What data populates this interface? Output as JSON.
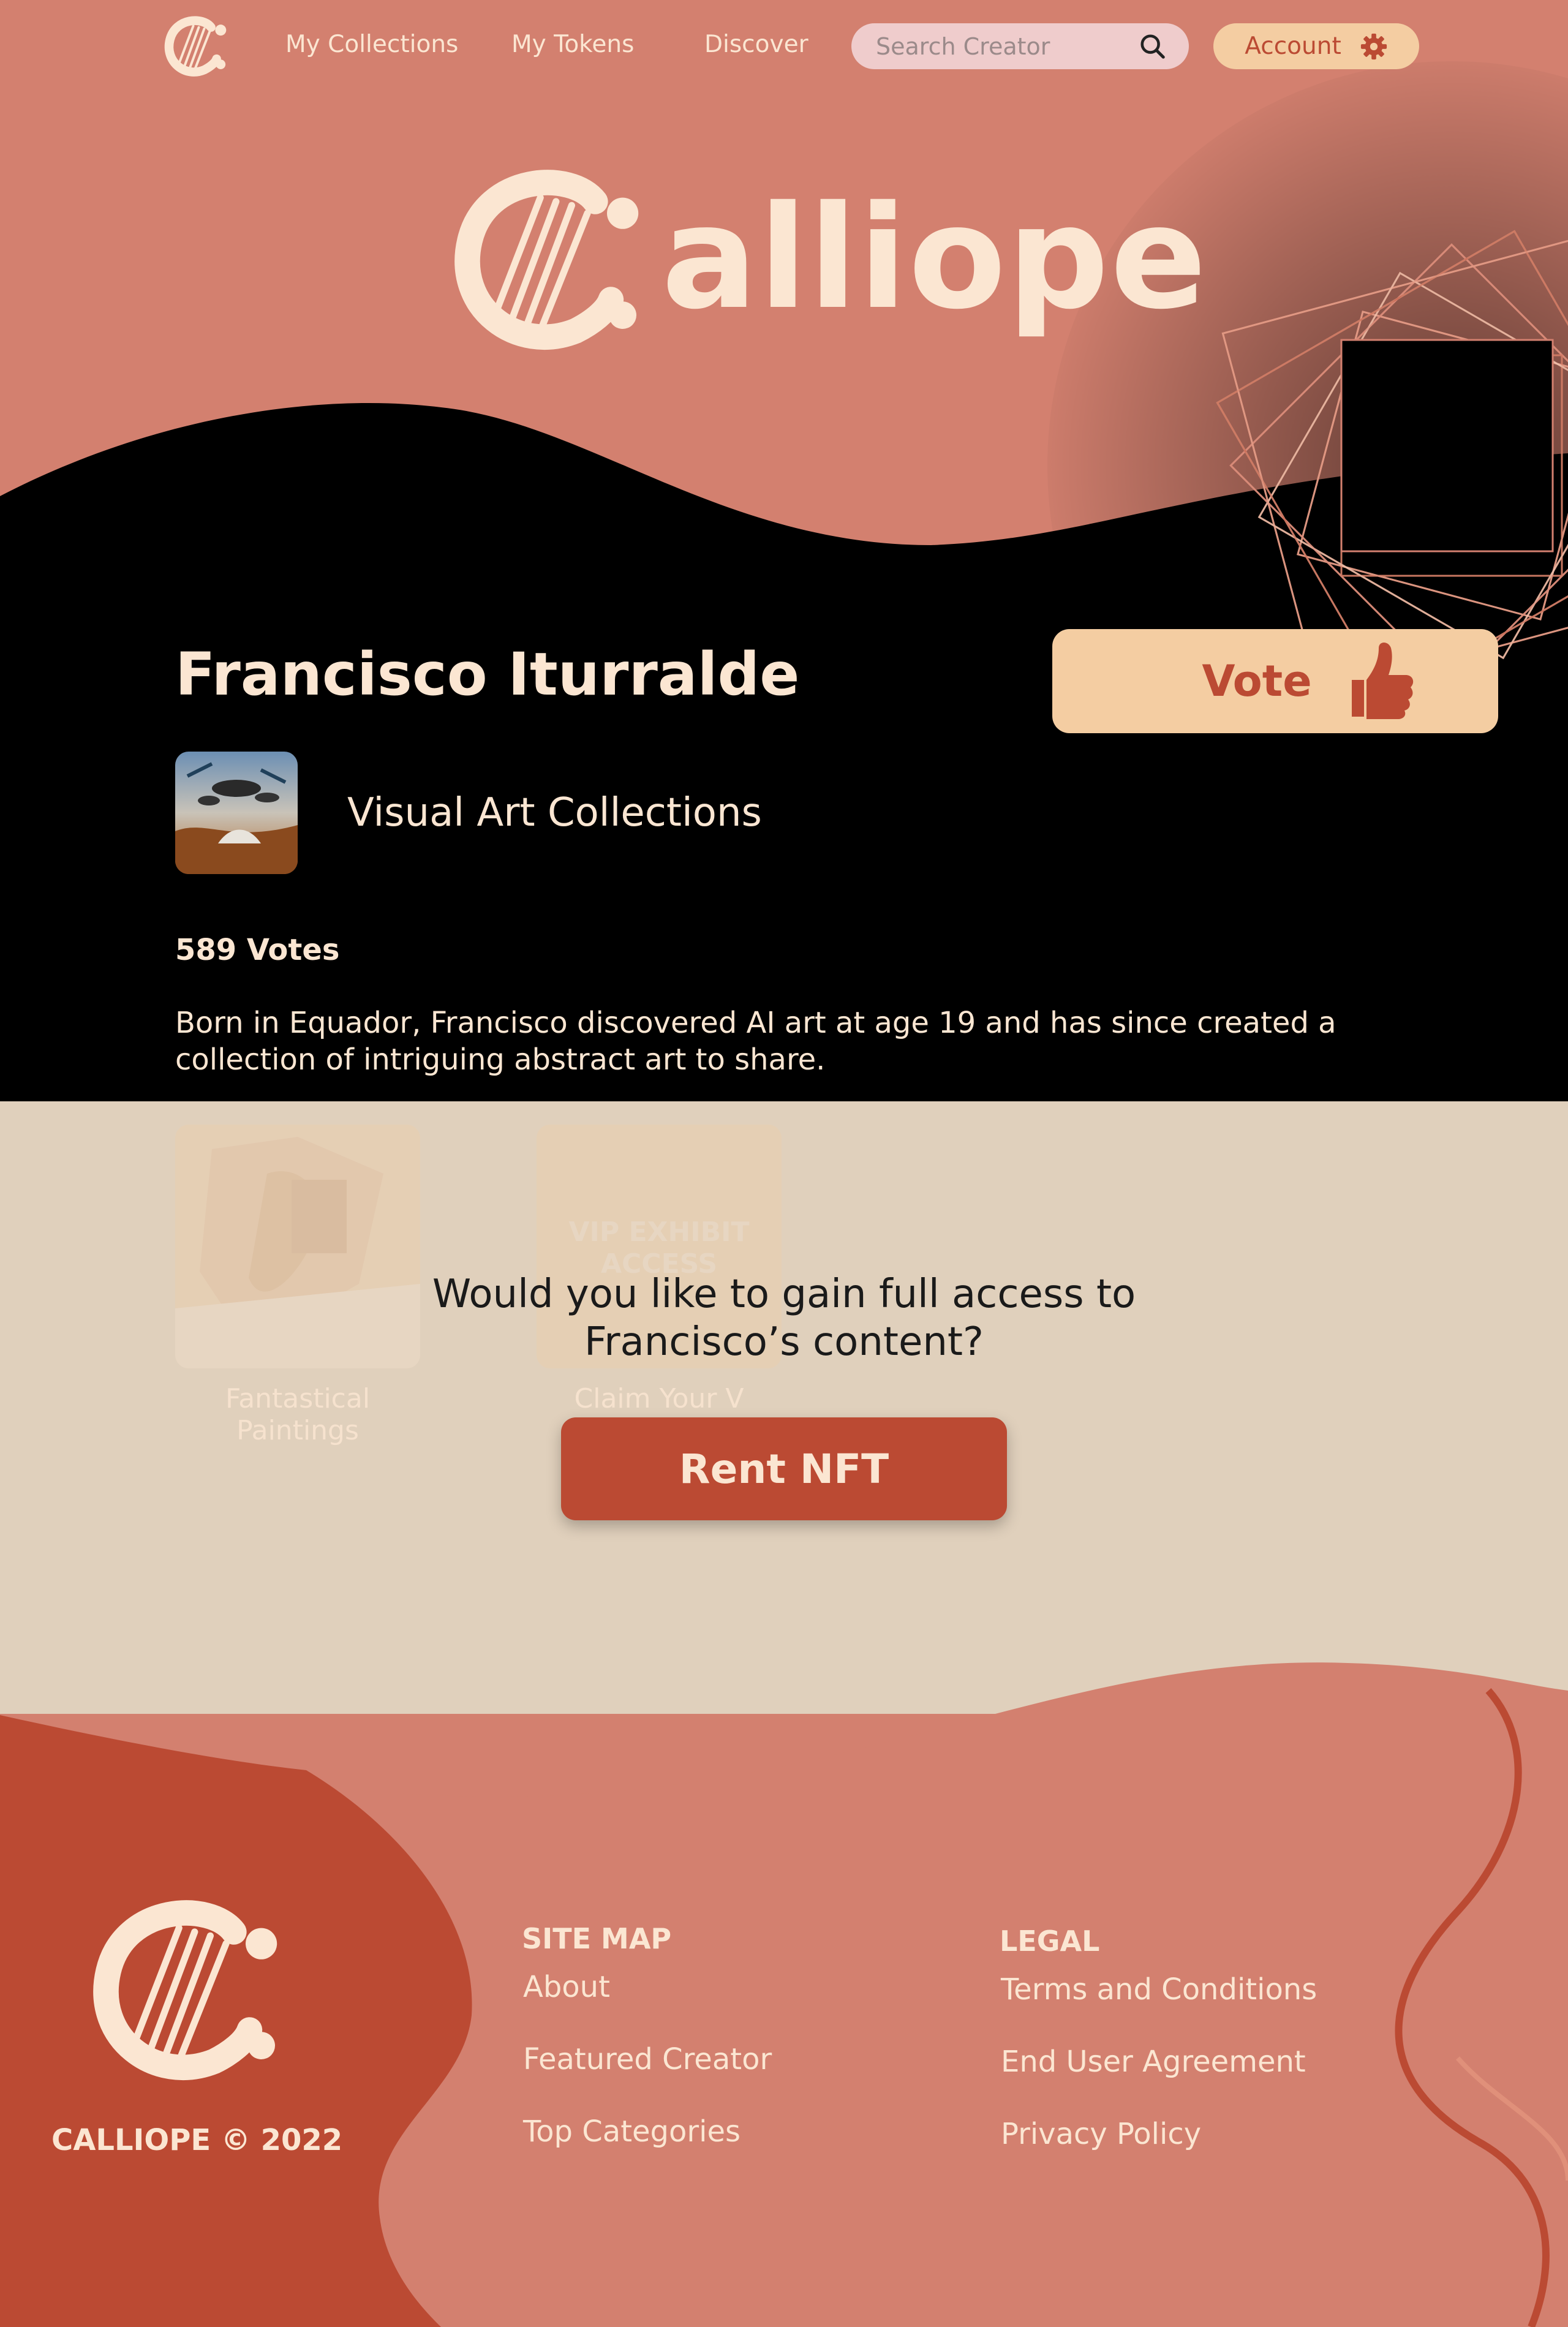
{
  "colors": {
    "salmon": "#d3806f",
    "cream": "#fbe6d2",
    "peach": "#f4cda2",
    "brick": "#bb4a33",
    "beige": "#e0d0bc",
    "black": "#000000"
  },
  "nav": {
    "logo_icon": "lyre-c-logo",
    "links": [
      "My Collections",
      "My Tokens",
      "Discover"
    ],
    "search_placeholder": "Search Creator",
    "search_icon": "search-icon",
    "account_label": "Account",
    "account_icon": "gear-icon"
  },
  "brand": {
    "wordmark_rest": "alliope"
  },
  "profile": {
    "name": "Francisco Iturralde",
    "vote_label": "Vote",
    "vote_icon": "thumbs-up-icon",
    "collection_title": "Visual Art Collections",
    "votes": "589 Votes",
    "bio": "Born in Equador, Francisco discovered AI art at age 19 and has since created a collection of intriguing abstract art to share."
  },
  "locked": {
    "cards": [
      {
        "caption": "Fantastical Paintings"
      },
      {
        "caption": "Claim Your V",
        "card_text": "VIP EXHIBIT ACCESS"
      }
    ],
    "question": "Would you like to gain full access to Francisco’s content?",
    "rent_label": "Rent NFT"
  },
  "footer": {
    "copyright": "CALLIOPE © 2022",
    "sitemap_heading": "SITE MAP",
    "sitemap_links": [
      "About",
      "Featured Creator",
      "Top Categories"
    ],
    "legal_heading": "LEGAL",
    "legal_links": [
      "Terms and Conditions",
      "End User Agreement",
      "Privacy Policy"
    ]
  }
}
